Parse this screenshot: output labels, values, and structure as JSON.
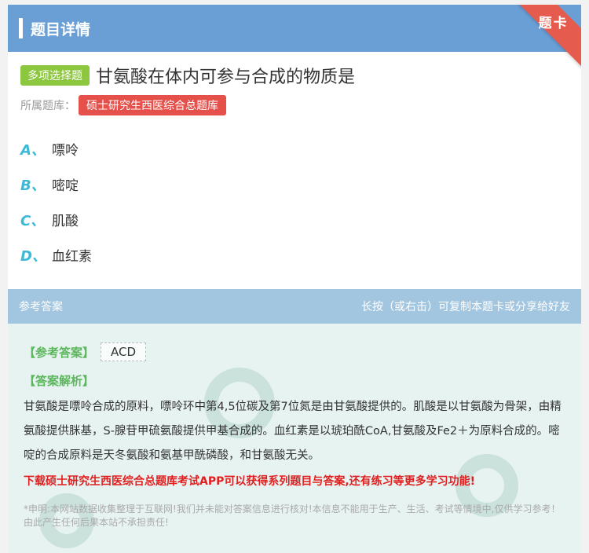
{
  "header": {
    "title": "题目详情",
    "ribbon": "题卡"
  },
  "question": {
    "type_badge": "多项选择题",
    "text": "甘氨酸在体内可参与合成的物质是",
    "bank_label": "所属题库：",
    "bank_name": "硕士研究生西医综合总题库",
    "options": [
      {
        "letter": "A、",
        "text": "嘌呤"
      },
      {
        "letter": "B、",
        "text": "嘧啶"
      },
      {
        "letter": "C、",
        "text": "肌酸"
      },
      {
        "letter": "D、",
        "text": "血红素"
      }
    ]
  },
  "answer": {
    "head_left": "参考答案",
    "head_right": "长按（或右击）可复制本题卡或分享给好友",
    "ref_label": "【参考答案】",
    "ref_value": "ACD",
    "analysis_label": "【答案解析】",
    "analysis_text": "甘氨酸是嘌呤合成的原料，嘌呤环中第4,5位碳及第7位氮是由甘氨酸提供的。肌酸是以甘氨酸为骨架，由精氨酸提供脒基，S-腺苷甲硫氨酸提供甲基合成的。血红素是以琥珀酰CoA,甘氨酸及Fe2＋为原料合成的。嘧啶的合成原料是天冬氨酸和氨基甲酰磷酸，和甘氨酸无关。",
    "promo": "下载硕士研究生西医综合总题库考试APP可以获得系列题目与答案,还有练习等更多学习功能!",
    "disclaimer": "*申明:本网站数据收集整理于互联网!我们并未能对答案信息进行核对!本信息不能用于生产、生活、考试等情境中,仅供学习参考！由此产生任何后果本站不承担责任!"
  },
  "colors": {
    "header_bg": "#6a9fd6",
    "ribbon": "#e55b4d",
    "type_badge": "#8dc63f",
    "bank_badge": "#e5504a",
    "option_letter": "#3cb9d6",
    "answer_bg": "#e7f3f1",
    "promo": "#e02020"
  }
}
